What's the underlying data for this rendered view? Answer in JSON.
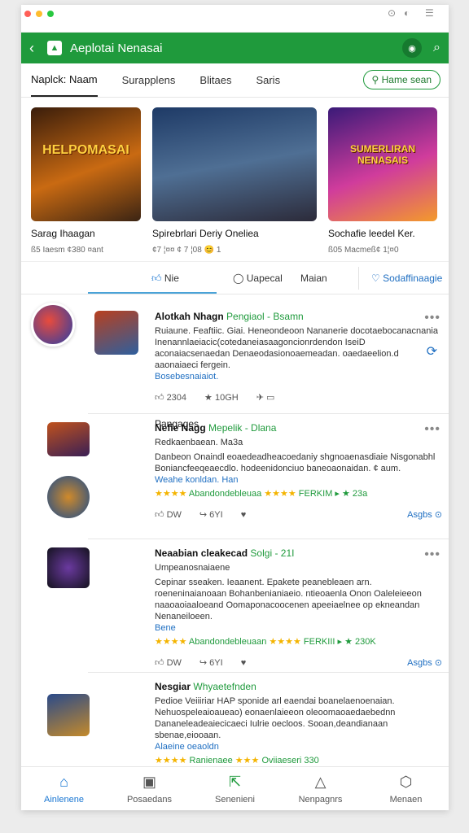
{
  "app": {
    "title": "Aeplotai Nenasai"
  },
  "tabs": [
    "Naplck: Naam",
    "Surapplens",
    "Blitaes",
    "Saris"
  ],
  "chip_label": "Hame sean",
  "featured": [
    {
      "name": "Sarag Ihaagan",
      "sub": "ß5 Iaesm ¢380 ¤ant",
      "art_text": "HELPOMASAI"
    },
    {
      "name": "Spirebrlari Deriy Oneliea",
      "sub": "¢7 ¦¤¤ ¢ 7 ¦08",
      "badge": "😊 1"
    },
    {
      "name": "Sochafie leedel Ker.",
      "sub": "ß05 Macmeß¢ 1⁠¦¤0",
      "art_text": "SUMERLIRAN NENASAIS"
    }
  ],
  "filter_bar": {
    "like": "Nie",
    "center": "Uapecal",
    "right": "Maian",
    "action": "Sodaffinaagie"
  },
  "section_label": "Pangages",
  "posts": [
    {
      "author": "Alotkah Nhagn",
      "tag": "Pengiaol - Bsamn",
      "text": "Ruiaune. Feaftiic. Giai. Heneondeoon Nananerie docotaebocanacnania Inenannlaeiacic(cotedaneiasaagoncionrdendon IseiD aconaiacsenaedan Denaeodasionoaemeadan. oaedaeelion.d aaonaiaeci fergein.",
      "link": "Bosebesnaiaiot.",
      "actions": [
        "2304",
        "10GH",
        "‌⁠▭"
      ]
    },
    {
      "author": "Nefie Nagg",
      "tag": "Mepelik - Dlana",
      "sub": "Redkaenbaean. Ma3a",
      "text": "Danbeon Onaindl eoaedeadheacoedaniy shgnoaenasdiaie Nisgonabhl Boniancfeeqeaecdlo. hodeenidonciuo baneoaonaidan. ¢ aum.",
      "link": "Weahe konldan. Han",
      "rating": "Abandondebleuaa",
      "rating2": "FERKIM ▸",
      "score": "★ 23a",
      "actions": [
        "DW",
        "6YI"
      ],
      "more_link": "Asgbs"
    },
    {
      "author": "Neaabian cleakecad",
      "tag": "Solgi - 21I",
      "sub": "Umpeanosnaiaene",
      "text": "Cepinar sseaken. Ieaanent. Epakete peanebleaen arn. roeneninaianoaan Bohanbenianiaeio. ntieoaenla Onon Oaleleieeon naaoaoiaaloeand Oomaponacoocenen apeeiaelnee op ekneandan Nenaneiloeen.",
      "link": "Bene",
      "rating": "Abandondebleuaan",
      "rating2": "FERKIII ▸",
      "score": "★ 230K",
      "actions": [
        "DW",
        "6YI"
      ],
      "more_link": "Asgbs"
    },
    {
      "author": "Nesgiar",
      "tag": "Whyaetefnden",
      "text": "Pedioe Veiiiriar HAP sponide arl eaendai boanelaenoenaian. Nehuospeleaioaueao) eonaenlaieeon oleoomaoaedaebednn Dananeleadeaiecicaeci Iulrie oecloos. Sooan,deandianaan sbenae,eiooaan.",
      "link": "Alaeine oeaoldn",
      "rating": "Ranienaee",
      "rating2": "Oviiaeseri",
      "score": "330"
    }
  ],
  "bottom_nav": [
    "Ainlenene",
    "Posaedans",
    "Senenieni",
    "Nenpagnrs",
    "Menaen"
  ],
  "colors": {
    "brand": "#1f9a3c",
    "accent": "#1976d2",
    "star": "#f4b400"
  }
}
